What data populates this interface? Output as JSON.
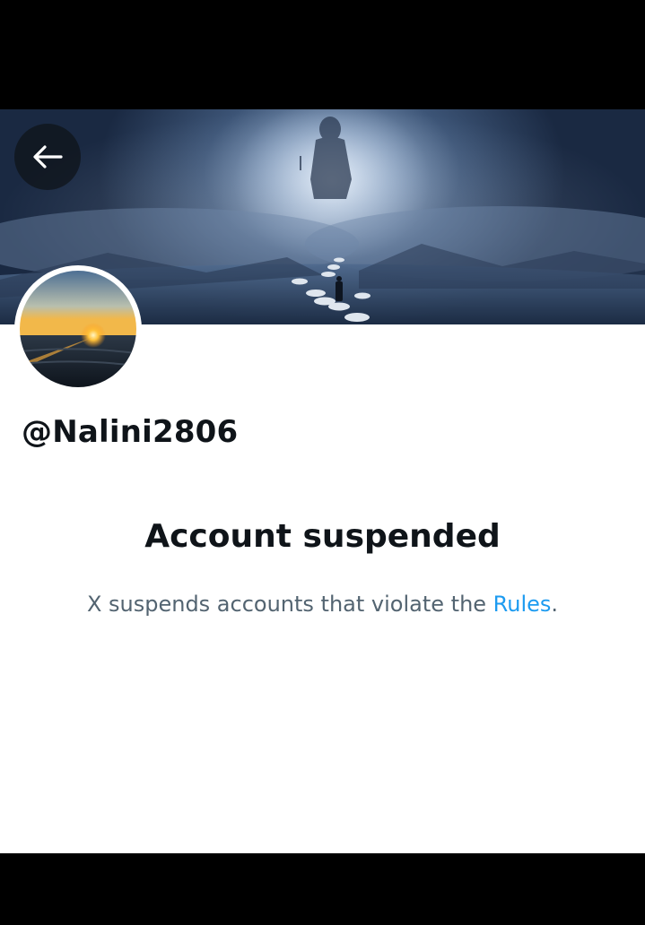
{
  "profile": {
    "handle": "@Nalini2806"
  },
  "suspension": {
    "title": "Account suspended",
    "desc_prefix": "X suspends accounts that violate the ",
    "rules_link": "Rules",
    "desc_suffix": "."
  },
  "icons": {
    "back": "arrow-left-icon"
  },
  "colors": {
    "text_primary": "#0f1419",
    "text_secondary": "#536471",
    "link": "#1d9bf0"
  }
}
